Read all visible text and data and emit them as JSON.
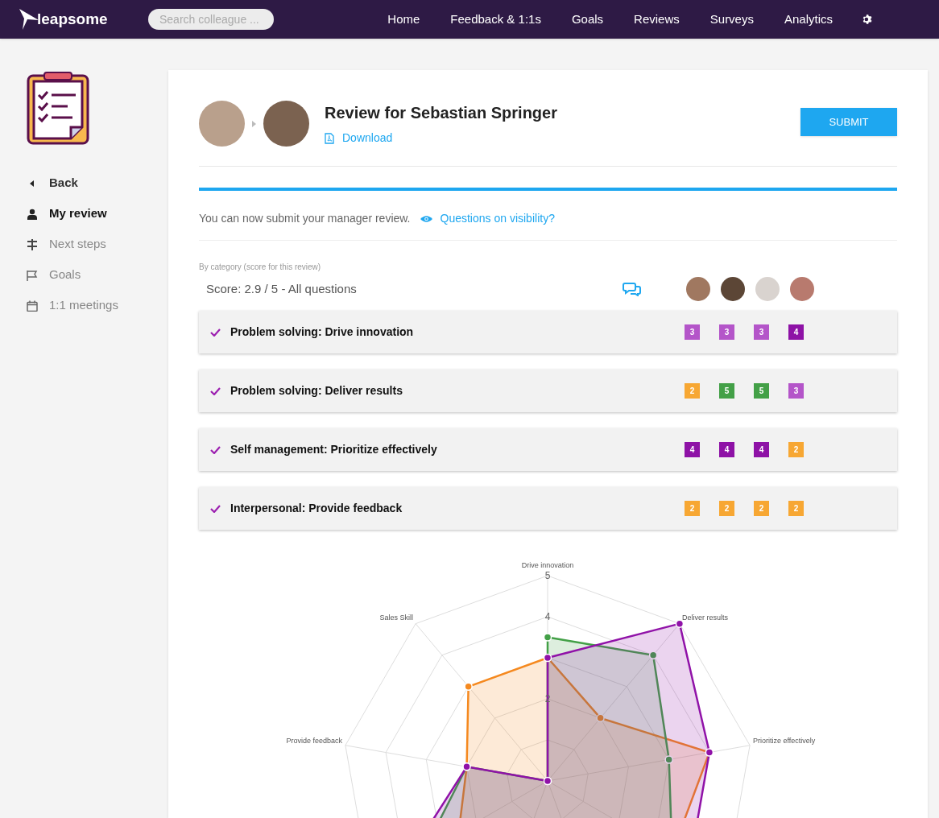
{
  "nav": {
    "logo": "leapsome",
    "search": {
      "placeholder": "Search colleague ..."
    },
    "links": [
      "Home",
      "Feedback & 1:1s",
      "Goals",
      "Reviews",
      "Surveys",
      "Analytics"
    ]
  },
  "sidebar": {
    "items": [
      {
        "kind": "back",
        "label": "Back",
        "selected": false
      },
      {
        "kind": "person",
        "label": "My review",
        "selected": true
      },
      {
        "kind": "signpost",
        "label": "Next steps",
        "selected": false
      },
      {
        "kind": "flag",
        "label": "Goals",
        "selected": false
      },
      {
        "kind": "calendar",
        "label": "1:1 meetings",
        "selected": false
      }
    ]
  },
  "review": {
    "title": "Review for Sebastian Springer",
    "download": "Download",
    "submit": "SUBMIT",
    "progress": {
      "level": 1
    },
    "notice": "You can now submit your manager review.",
    "visibility_link": "Questions on visibility?",
    "category_caption": "By category (score for this review)",
    "score": "Score: 2.9 / 5 - All questions",
    "rows": [
      {
        "label": "Problem solving: Drive innovation",
        "checked": true,
        "scores": [
          {
            "value": "3",
            "color": "#b455c9"
          },
          {
            "value": "3",
            "color": "#b455c9"
          },
          {
            "value": "3",
            "color": "#b455c9"
          },
          {
            "value": "4",
            "color": "#8e12a6"
          }
        ]
      },
      {
        "label": "Problem solving: Deliver results",
        "checked": true,
        "scores": [
          {
            "value": "2",
            "color": "#f7a733"
          },
          {
            "value": "5",
            "color": "#43a047"
          },
          {
            "value": "5",
            "color": "#43a047"
          },
          {
            "value": "3",
            "color": "#b455c9"
          }
        ]
      },
      {
        "label": "Self management: Prioritize effectively",
        "checked": true,
        "scores": [
          {
            "value": "4",
            "color": "#8e12a6"
          },
          {
            "value": "4",
            "color": "#8e12a6"
          },
          {
            "value": "4",
            "color": "#8e12a6"
          },
          {
            "value": "2",
            "color": "#f7a733"
          }
        ]
      },
      {
        "label": "Interpersonal: Provide feedback",
        "checked": true,
        "scores": [
          {
            "value": "2",
            "color": "#f7a733"
          },
          {
            "value": "2",
            "color": "#f7a733"
          },
          {
            "value": "2",
            "color": "#f7a733"
          },
          {
            "value": "2",
            "color": "#f7a733"
          }
        ]
      }
    ],
    "radar": {
      "axis_labels": [
        "Drive innovation",
        "Sales Skill",
        "Deliver results",
        "Provide feedback",
        "Prioritize effectively"
      ],
      "tick_labels": [
        "5",
        "4",
        "2"
      ]
    }
  }
}
